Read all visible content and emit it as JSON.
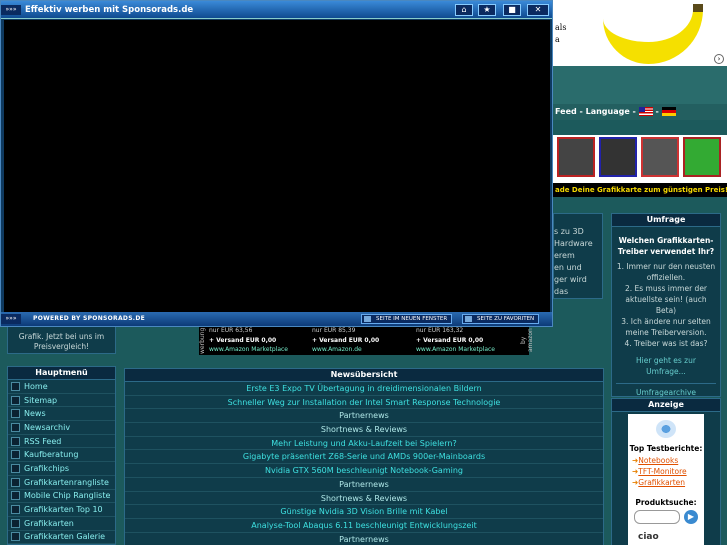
{
  "popup": {
    "title": "Effektiv werben mit Sponsorads.de",
    "arrows": "»»»",
    "powered_by": "POWERED BY SPONSORADS.DE",
    "open_new_window": "SEITE IM NEUEN FENSTER",
    "add_favorites": "SEITE ZU FAVORITEN",
    "buttons": {
      "home": "⌂",
      "star": "★",
      "restore": "■",
      "close": "✕"
    }
  },
  "banner_top": {
    "text_line1": "als",
    "text_line2": "a"
  },
  "language_bar": {
    "label": "Feed - Language -",
    "sep": "-"
  },
  "gpu_banner": {
    "caption": "ade Deine Grafikkarte zum günstigen Preis!"
  },
  "article_snippet": {
    "lines": [
      "s zu 3D",
      "Hardware",
      "erem",
      "en und",
      "ger wird das"
    ]
  },
  "umfrage": {
    "title": "Umfrage",
    "question": "Welchen Grafikkarten-Treiber verwendet Ihr?",
    "options": [
      "1. Immer nur den neusten offiziellen.",
      "2. Es muss immer der aktuellste sein! (auch Beta)",
      "3. Ich ändere nur selten meine Treiberversion.",
      "4. Treiber was ist das?"
    ],
    "link": "Hier geht es zur Umfrage...",
    "archive": "Umfragearchive"
  },
  "anzeige": {
    "title": "Anzeige",
    "top_title": "Top Testberichte:",
    "items": [
      "Notebooks",
      "TFT-Monitore",
      "Grafikkarten"
    ],
    "product_search": "Produktsuche:",
    "go": "▶",
    "brand": "ciao"
  },
  "price_compare": {
    "line1": "Grafik. Jetzt bei uns im",
    "line2": "Preisvergleich!"
  },
  "amazon": {
    "side_left": "werbung",
    "side_right": "by amazon",
    "columns": [
      {
        "price": "nur EUR 63,56",
        "shipping": "+ Versand EUR 0,00",
        "link": "www.Amazon Marketplace"
      },
      {
        "price": "nur EUR 85,39",
        "shipping": "+ Versand EUR 0,00",
        "link": "www.Amazon.de"
      },
      {
        "price": "nur EUR 163,32",
        "shipping": "+ Versand EUR 0,00",
        "link": "www.Amazon Marketplace"
      }
    ]
  },
  "hauptmenu": {
    "title": "Hauptmenü",
    "items": [
      "Home",
      "Sitemap",
      "News",
      "Newsarchiv",
      "RSS Feed",
      "Kaufberatung",
      "Grafikchips",
      "Grafikkartenrangliste",
      "Mobile Chip Rangliste",
      "Grafikkarten Top 10",
      "Grafikkarten",
      "Grafikkarten Galerie"
    ]
  },
  "news": {
    "title": "Newsübersicht",
    "items": [
      "Erste E3 Expo TV Übertagung in dreidimensionalen Bildern",
      "Schneller Weg zur Installation der Intel Smart Response Technologie",
      "Partnernews",
      "Shortnews & Reviews",
      "Mehr Leistung und Akku-Laufzeit bei Spielern?",
      "Gigabyte präsentiert Z68-Serie und AMDs 900er-Mainboards",
      "Nvidia GTX 560M beschleunigt Notebook-Gaming",
      "Partnernews",
      "Shortnews & Reviews",
      "Günstige Nvidia 3D Vision Brille mit Kabel",
      "Analyse-Tool Abaqus 6.11 beschleunigt Entwicklungszeit",
      "Partnernews"
    ]
  }
}
